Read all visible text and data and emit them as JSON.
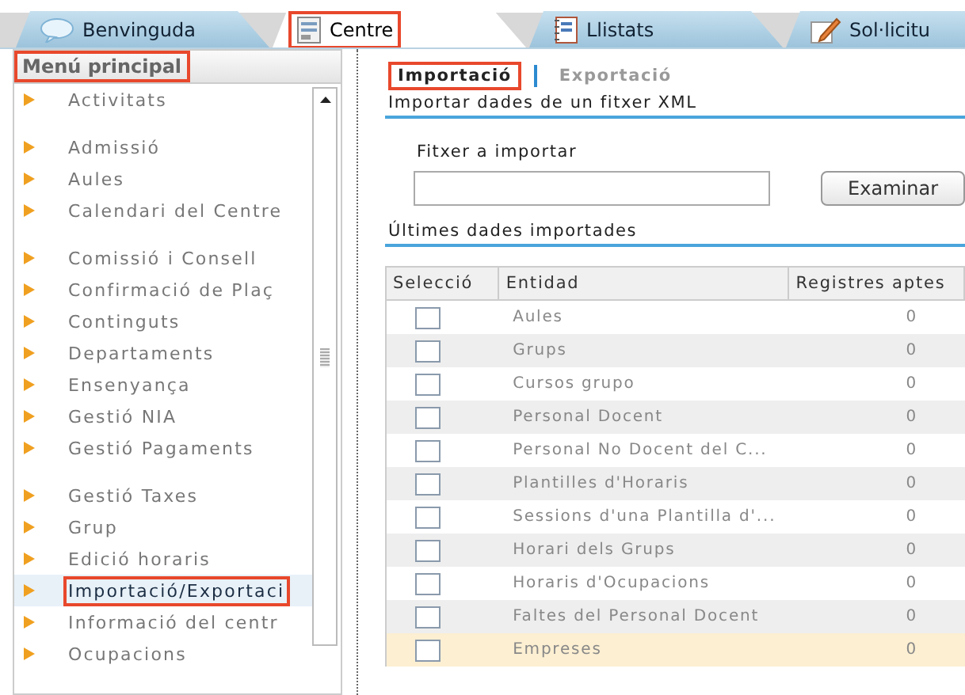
{
  "tabs": [
    {
      "label": "Benvinguda",
      "kind": "chat",
      "selected": false,
      "highlighted": false
    },
    {
      "label": "Centre",
      "kind": "form",
      "selected": true,
      "highlighted": true
    },
    {
      "label": "Llistats",
      "kind": "notebook",
      "selected": false,
      "highlighted": false
    },
    {
      "label": "Sol·licitu",
      "kind": "pencil",
      "selected": false,
      "highlighted": false
    }
  ],
  "sidebar": {
    "title": "Menú principal",
    "title_highlighted": true,
    "groups": [
      {
        "items": [
          {
            "label": "Activitats",
            "selected": false,
            "highlighted": false
          }
        ]
      },
      {
        "items": [
          {
            "label": "Admissió",
            "selected": false,
            "highlighted": false
          },
          {
            "label": "Aules",
            "selected": false,
            "highlighted": false
          },
          {
            "label": "Calendari del Centre",
            "selected": false,
            "highlighted": false
          }
        ]
      },
      {
        "items": [
          {
            "label": "Comissió i Consell",
            "selected": false,
            "highlighted": false
          },
          {
            "label": "Confirmació de Plaç",
            "selected": false,
            "highlighted": false
          },
          {
            "label": "Continguts",
            "selected": false,
            "highlighted": false
          },
          {
            "label": "Departaments",
            "selected": false,
            "highlighted": false
          },
          {
            "label": "Ensenyança",
            "selected": false,
            "highlighted": false
          },
          {
            "label": "Gestió NIA",
            "selected": false,
            "highlighted": false
          },
          {
            "label": "Gestió Pagaments",
            "selected": false,
            "highlighted": false
          }
        ]
      },
      {
        "items": [
          {
            "label": "Gestió Taxes",
            "selected": false,
            "highlighted": false
          },
          {
            "label": "Grup",
            "selected": false,
            "highlighted": false
          },
          {
            "label": "Edició horaris",
            "selected": false,
            "highlighted": false
          },
          {
            "label": "Importació/Exportaci",
            "selected": true,
            "highlighted": true
          },
          {
            "label": "Informació del centr",
            "selected": false,
            "highlighted": false
          },
          {
            "label": "Ocupacions",
            "selected": false,
            "highlighted": false
          }
        ]
      }
    ]
  },
  "subtabs": [
    {
      "label": "Importació",
      "selected": true,
      "highlighted": true
    },
    {
      "label": "Exportació",
      "selected": false,
      "highlighted": false
    }
  ],
  "import_section": {
    "title": "Importar dades de un fitxer XML",
    "field_label": "Fitxer a importar",
    "button": "Examinar"
  },
  "table": {
    "title": "Últimes dades importades",
    "columns": [
      "Selecció",
      "Entidad",
      "Registres aptes"
    ],
    "rows": [
      {
        "entity": "Aules",
        "count": "0",
        "checked": false,
        "selected": false
      },
      {
        "entity": "Grups",
        "count": "0",
        "checked": false,
        "selected": false
      },
      {
        "entity": "Cursos grupo",
        "count": "0",
        "checked": false,
        "selected": false
      },
      {
        "entity": "Personal Docent",
        "count": "0",
        "checked": false,
        "selected": false
      },
      {
        "entity": "Personal No Docent del C...",
        "count": "0",
        "checked": false,
        "selected": false
      },
      {
        "entity": "Plantilles d'Horaris",
        "count": "0",
        "checked": false,
        "selected": false
      },
      {
        "entity": "Sessions d'una Plantilla d'...",
        "count": "0",
        "checked": false,
        "selected": false
      },
      {
        "entity": "Horari dels Grups",
        "count": "0",
        "checked": false,
        "selected": false
      },
      {
        "entity": "Horaris d'Ocupacions",
        "count": "0",
        "checked": false,
        "selected": false
      },
      {
        "entity": "Faltes del Personal Docent",
        "count": "0",
        "checked": false,
        "selected": false
      },
      {
        "entity": "Empreses",
        "count": "0",
        "checked": false,
        "selected": true
      }
    ]
  }
}
